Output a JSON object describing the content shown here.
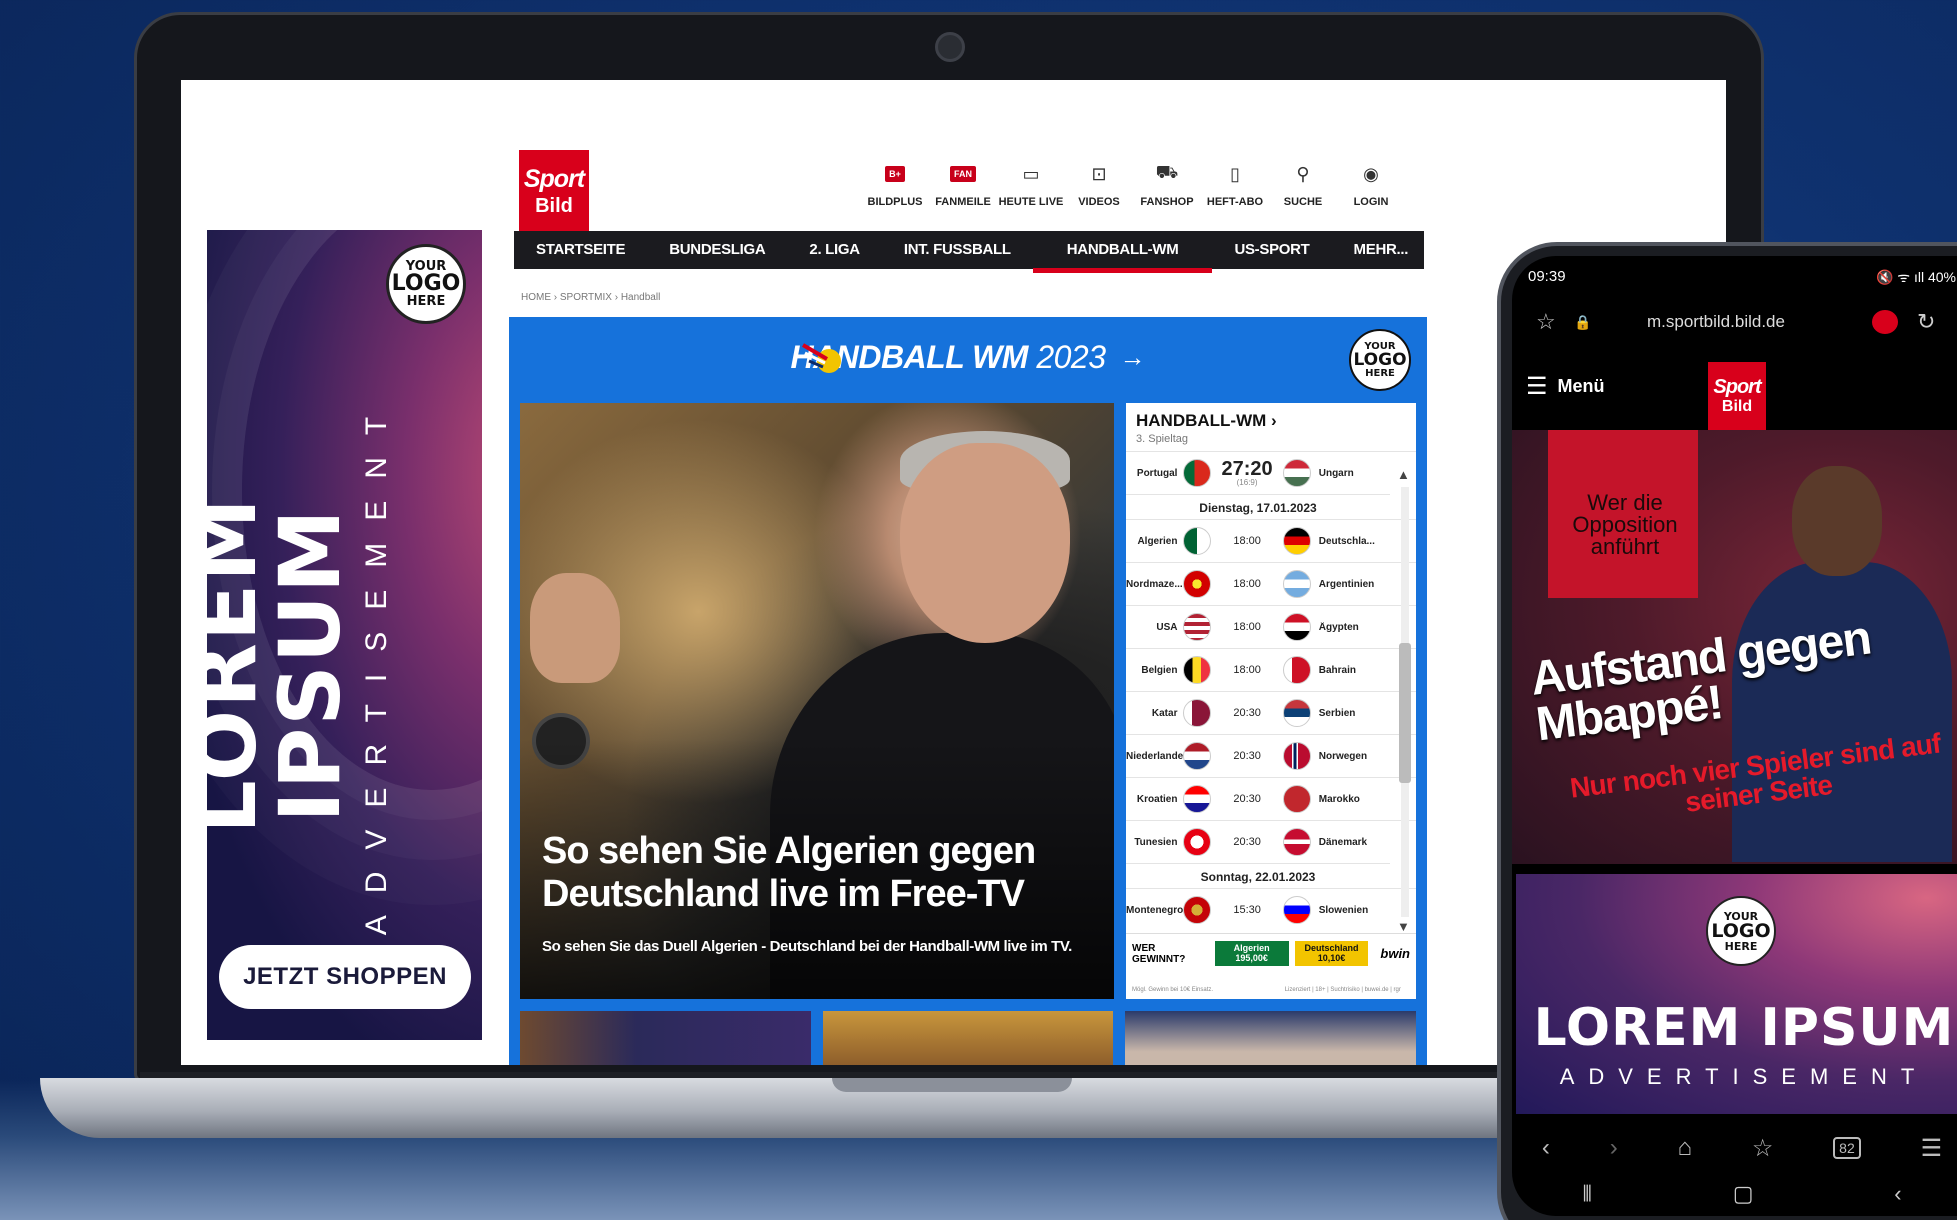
{
  "colors": {
    "brand_red": "#d8001b",
    "handball_blue": "#1672db",
    "nav_dark": "#1b1b1f"
  },
  "sky_ad": {
    "title": "LOREM IPSUM",
    "subtitle": "ADVERTISEMENT",
    "button": "JETZT SHOPPEN",
    "logo": [
      "YOUR",
      "LOGO",
      "HERE"
    ]
  },
  "site": {
    "logo_line1": "Sport",
    "logo_line2": "Bild",
    "topnav": [
      {
        "label": "BILDPLUS",
        "icon": "bildplus-icon"
      },
      {
        "label": "FANMEILE",
        "icon": "fanmeile-icon"
      },
      {
        "label": "HEUTE LIVE",
        "icon": "tv-icon"
      },
      {
        "label": "VIDEOS",
        "icon": "video-icon"
      },
      {
        "label": "FANSHOP",
        "icon": "cart-icon"
      },
      {
        "label": "HEFT-ABO",
        "icon": "magazine-icon"
      },
      {
        "label": "SUCHE",
        "icon": "search-icon"
      },
      {
        "label": "LOGIN",
        "icon": "user-icon"
      }
    ],
    "mainnav": [
      "STARTSEITE",
      "BUNDESLIGA",
      "2. LIGA",
      "INT. FUSSBALL",
      "HANDBALL-WM",
      "US-SPORT",
      "MEHR..."
    ],
    "mainnav_active": "HANDBALL-WM",
    "breadcrumb": "HOME › SPORTMIX › Handball"
  },
  "handball": {
    "title_main": "HANDBALL WM",
    "title_year": "2023",
    "arrow": "→",
    "logo": [
      "YOUR",
      "LOGO",
      "HERE"
    ],
    "hero_headline": "So sehen Sie Algerien gegen Deutschland live im Free-TV",
    "hero_sub": "So sehen Sie das Duell Algerien - Deutschland bei der Handball-WM live im TV.",
    "widget": {
      "title": "HANDBALL-WM ›",
      "subtitle": "3. Spieltag",
      "result": {
        "home": "Portugal",
        "score": "27:20",
        "halftime": "(16:9)",
        "away": "Ungarn"
      },
      "day1": "Dienstag, 17.01.2023",
      "matches_day1": [
        {
          "home": "Algerien",
          "time": "18:00",
          "away": "Deutschla..."
        },
        {
          "home": "Nordmaze...",
          "time": "18:00",
          "away": "Argentinien"
        },
        {
          "home": "USA",
          "time": "18:00",
          "away": "Ägypten"
        },
        {
          "home": "Belgien",
          "time": "18:00",
          "away": "Bahrain"
        },
        {
          "home": "Katar",
          "time": "20:30",
          "away": "Serbien"
        },
        {
          "home": "Niederlande",
          "time": "20:30",
          "away": "Norwegen"
        },
        {
          "home": "Kroatien",
          "time": "20:30",
          "away": "Marokko"
        },
        {
          "home": "Tunesien",
          "time": "20:30",
          "away": "Dänemark"
        }
      ],
      "day2": "Sonntag, 22.01.2023",
      "matches_day2": [
        {
          "home": "Montenegro",
          "time": "15:30",
          "away": "Slowenien"
        }
      ],
      "bet_label": "WER GEWINNT?",
      "bet1_team": "Algerien",
      "bet1_amount": "195,00€",
      "bet2_team": "Deutschland",
      "bet2_amount": "10,10€",
      "bet_brand": "bwin",
      "fine_print_left": "Mögl. Gewinn bei 10€ Einsatz.",
      "fine_print_right": "Lizenziert | 18+ | Suchtrisiko | buwei.de | rgr"
    }
  },
  "phone": {
    "time": "09:39",
    "status_right": "40%",
    "url": "m.sportbild.bild.de",
    "menu_label": "Menü",
    "logo_line1": "Sport",
    "logo_line2": "Bild",
    "story_kicker": "Wer die Opposition anführt",
    "story_headline": "Aufstand gegen Mbappé!",
    "story_sub": "Nur noch vier Spieler sind auf seiner Seite",
    "ad_title": "LOREM IPSUM",
    "ad_subtitle": "ADVERTISEMENT",
    "ad_logo": [
      "YOUR",
      "LOGO",
      "HERE"
    ]
  }
}
